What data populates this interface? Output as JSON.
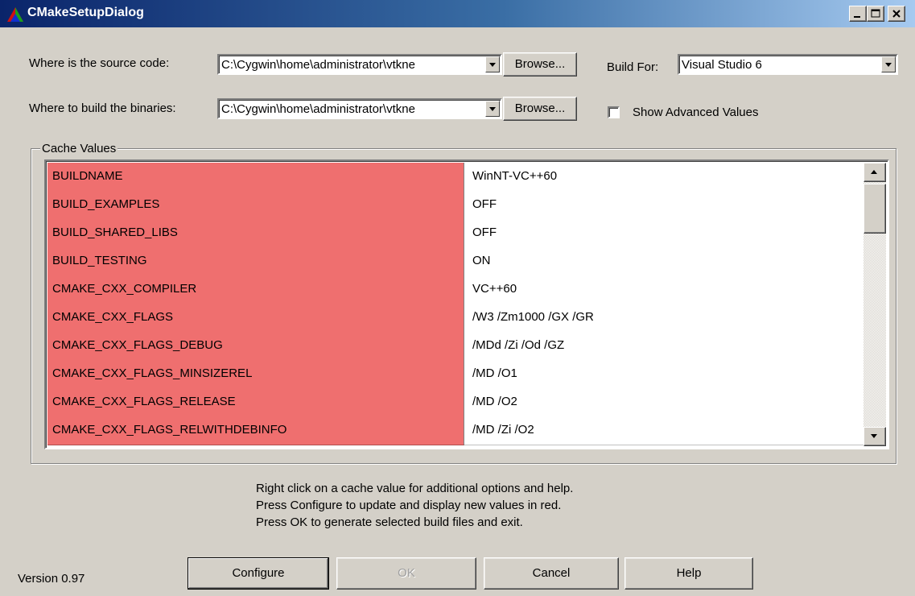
{
  "window": {
    "title": "CMakeSetupDialog"
  },
  "source": {
    "label": "Where is the source code:",
    "value": "C:\\Cygwin\\home\\administrator\\vtkne",
    "browse_label": "Browse..."
  },
  "binaries": {
    "label": "Where to build the binaries:",
    "value": "C:\\Cygwin\\home\\administrator\\vtkne",
    "browse_label": "Browse..."
  },
  "build_for": {
    "label": "Build For:",
    "value": "Visual Studio 6"
  },
  "advanced": {
    "label": "Show Advanced Values",
    "checked": false
  },
  "cache": {
    "group_label": "Cache Values",
    "rows": [
      {
        "key": "BUILDNAME",
        "value": "WinNT-VC++60"
      },
      {
        "key": "BUILD_EXAMPLES",
        "value": "OFF"
      },
      {
        "key": "BUILD_SHARED_LIBS",
        "value": "OFF"
      },
      {
        "key": "BUILD_TESTING",
        "value": "ON"
      },
      {
        "key": "CMAKE_CXX_COMPILER",
        "value": "VC++60"
      },
      {
        "key": "CMAKE_CXX_FLAGS",
        "value": "/W3 /Zm1000 /GX /GR"
      },
      {
        "key": "CMAKE_CXX_FLAGS_DEBUG",
        "value": "/MDd /Zi /Od /GZ"
      },
      {
        "key": "CMAKE_CXX_FLAGS_MINSIZEREL",
        "value": "/MD /O1"
      },
      {
        "key": "CMAKE_CXX_FLAGS_RELEASE",
        "value": "/MD /O2"
      },
      {
        "key": "CMAKE_CXX_FLAGS_RELWITHDEBINFO",
        "value": "/MD /Zi /O2"
      }
    ],
    "new_value_color": "#ef6f6f"
  },
  "help_text": {
    "line1": "Right click on a cache value for additional options and help.",
    "line2": "Press Configure to update and display new values in red.",
    "line3": "Press OK to generate selected build files and exit."
  },
  "buttons": {
    "configure": "Configure",
    "ok": "OK",
    "cancel": "Cancel",
    "help": "Help"
  },
  "version": "Version 0.97",
  "colors": {
    "titlebar_start": "#0a246a",
    "titlebar_end": "#a6caf0",
    "face": "#d4d0c8"
  }
}
